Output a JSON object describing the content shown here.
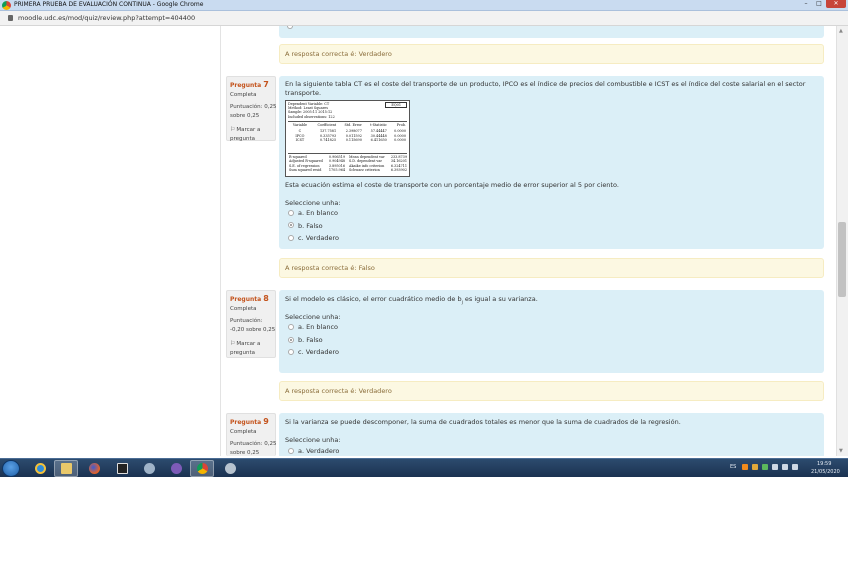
{
  "window": {
    "title": "PRIMERA PRUEBA DE EVALUACIÓN CONTINUA - Google Chrome",
    "min_label": "–",
    "max_label": "□",
    "close_label": "✕"
  },
  "address": {
    "url": "moodle.udc.es/mod/quiz/review.php?attempt=404400"
  },
  "top_answer": "A resposta correcta é: Verdadero",
  "questions": [
    {
      "label": "Pregunta",
      "number": "7",
      "state": "Completa",
      "grade": "Puntuación: 0,25 sobre 0,25",
      "flag": "Marcar a pregunta",
      "text": "En la siguiente tabla CT es el coste del transporte de un producto, IPCO es el índice de precios del combustible e ICST es el índice del coste salarial en el sector transporte.",
      "statement": "Esta ecuación estima el coste de transporte con un porcentaje medio de error superior al 5 por ciento.",
      "prompt": "Seleccione unha:",
      "options": [
        "a. En blanco",
        "b. Falso",
        "c. Verdadero"
      ],
      "selected": 1,
      "answer": "A resposta correcta é: Falso"
    },
    {
      "label": "Pregunta",
      "number": "8",
      "state": "Completa",
      "grade": "Puntuación: -0,20 sobre 0,25",
      "flag": "Marcar a pregunta",
      "text_before": "Si el modelo es clásico, el error cuadrático medio de b",
      "text_sub": "j",
      "text_after": " es igual a su varianza.",
      "prompt": "Seleccione unha:",
      "options": [
        "a. En blanco",
        "b. Falso",
        "c. Verdadero"
      ],
      "selected": 1,
      "answer": "A resposta correcta é: Verdadero"
    },
    {
      "label": "Pregunta",
      "number": "9",
      "state": "Completa",
      "grade": "Puntuación: 0,25 sobre 0,25",
      "text": "Si la varianza se puede descomponer, la suma de cuadrados totales es menor que la suma de cuadrados de la regresión.",
      "prompt": "Seleccione unha:",
      "options": [
        "a. Verdadero"
      ]
    }
  ],
  "regression": {
    "header": [
      "Dependent Variable: CT",
      "Method: Least Squares",
      "Sample: 2005:11 2015:12",
      "Included observations: 122"
    ],
    "eq_button": "EQ01",
    "columns": [
      "Variable",
      "Coefficient",
      "Std. Error",
      "t-Statistic",
      "Prob."
    ],
    "rows": [
      [
        "C",
        "137.7581",
        "2.398077",
        "57.44447",
        "0.0000"
      ],
      [
        "IPCO",
        "0.335793",
        "0.011592",
        "30.44448",
        "0.0000"
      ],
      [
        "ICST",
        "0.741825",
        "0.115690",
        "6.411650",
        "0.0000"
      ]
    ],
    "stats_left": [
      [
        "R-squared",
        "0.906519"
      ],
      [
        "Adjusted R-squared",
        "0.904948"
      ],
      [
        "S.E. of regression",
        "3.895016"
      ],
      [
        "Sum squared resid",
        "1705.964"
      ]
    ],
    "stats_right": [
      [
        "Mean dependent var",
        "233.8739"
      ],
      [
        "S.D. dependent var",
        "34.16201"
      ],
      [
        "Akaike info criterion",
        "6.324711"
      ],
      [
        "Schwarz criterion",
        "6.393902"
      ]
    ]
  },
  "taskbar": {
    "language": "ES",
    "time": "19:59",
    "date": "21/05/2020"
  },
  "colors": {
    "question_bg": "#dbeff7",
    "answer_bg": "#fcf8e2",
    "answer_text": "#8a6d3b",
    "question_number": "#c4531c"
  }
}
